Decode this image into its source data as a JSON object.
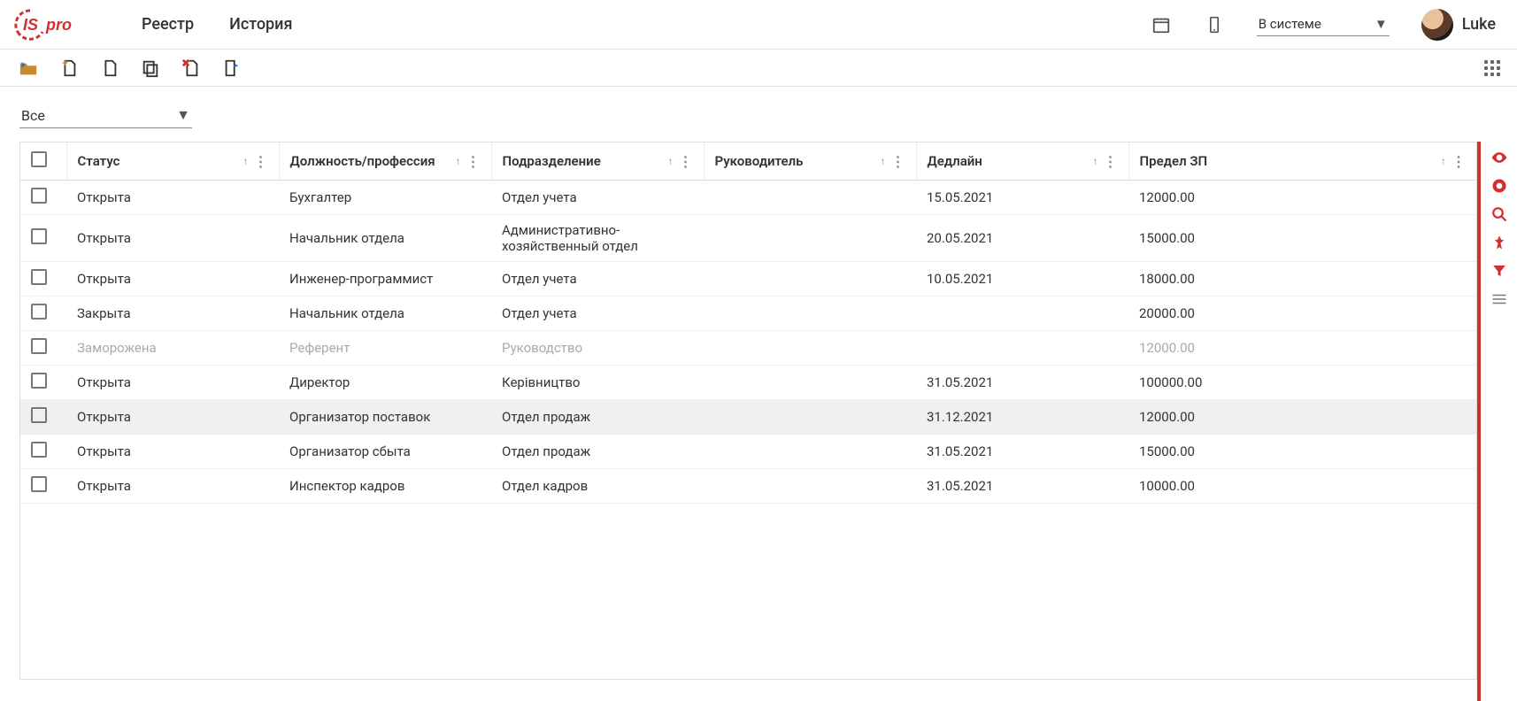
{
  "header": {
    "nav": [
      "Реестр",
      "История"
    ],
    "status_label": "В системе",
    "username": "Luke"
  },
  "filter": {
    "label": "Все"
  },
  "columns": [
    {
      "label": "Статус"
    },
    {
      "label": "Должность/профессия"
    },
    {
      "label": "Подразделение"
    },
    {
      "label": "Руководитель"
    },
    {
      "label": "Дедлайн"
    },
    {
      "label": "Предел ЗП"
    }
  ],
  "rows": [
    {
      "status": "Открыта",
      "position": "Бухгалтер",
      "dept": "Отдел учета",
      "mgr": "",
      "deadline": "15.05.2021",
      "salary": "12000.00",
      "frozen": false,
      "selected": false
    },
    {
      "status": "Открыта",
      "position": "Начальник отдела",
      "dept": "Административно-хозяйственный отдел",
      "mgr": "",
      "deadline": "20.05.2021",
      "salary": "15000.00",
      "frozen": false,
      "selected": false
    },
    {
      "status": "Открыта",
      "position": "Инженер-программист",
      "dept": "Отдел учета",
      "mgr": "",
      "deadline": "10.05.2021",
      "salary": "18000.00",
      "frozen": false,
      "selected": false
    },
    {
      "status": "Закрыта",
      "position": "Начальник отдела",
      "dept": "Отдел учета",
      "mgr": "",
      "deadline": "",
      "salary": "20000.00",
      "frozen": false,
      "selected": false
    },
    {
      "status": "Заморожена",
      "position": "Референт",
      "dept": "Руководство",
      "mgr": "",
      "deadline": "",
      "salary": "12000.00",
      "frozen": true,
      "selected": false
    },
    {
      "status": "Открыта",
      "position": "Директор",
      "dept": "Керівництво",
      "mgr": "",
      "deadline": "31.05.2021",
      "salary": "100000.00",
      "frozen": false,
      "selected": false
    },
    {
      "status": "Открыта",
      "position": "Организатор поставок",
      "dept": "Отдел продаж",
      "mgr": "",
      "deadline": "31.12.2021",
      "salary": "12000.00",
      "frozen": false,
      "selected": true
    },
    {
      "status": "Открыта",
      "position": "Организатор сбыта",
      "dept": "Отдел продаж",
      "mgr": "",
      "deadline": "31.05.2021",
      "salary": "15000.00",
      "frozen": false,
      "selected": false
    },
    {
      "status": "Открыта",
      "position": "Инспектор кадров",
      "dept": "Отдел кадров",
      "mgr": "",
      "deadline": "31.05.2021",
      "salary": "10000.00",
      "frozen": false,
      "selected": false
    }
  ]
}
